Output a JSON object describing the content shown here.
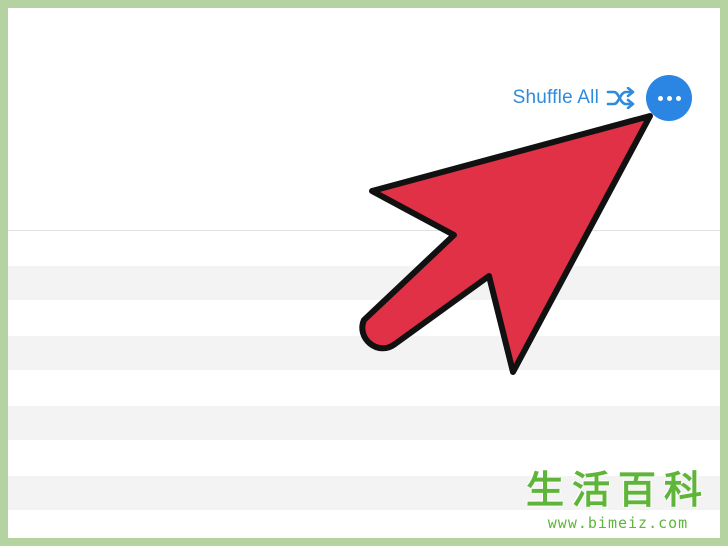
{
  "toolbar": {
    "shuffle_label": "Shuffle All",
    "shuffle_icon": "shuffle-icon",
    "more_icon": "ellipsis-icon"
  },
  "colors": {
    "accent": "#2a86e2",
    "arrow_fill": "#e03146",
    "page_border": "#b5d3a0"
  },
  "watermark": {
    "title": "生活百科",
    "url": "www.bimeiz.com"
  }
}
